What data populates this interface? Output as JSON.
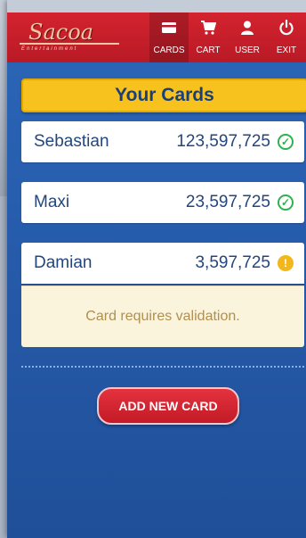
{
  "brand": {
    "logo_text": "Sacoa",
    "logo_sub": "Entertainment"
  },
  "nav": [
    {
      "label": "CARDS",
      "icon": "card-icon"
    },
    {
      "label": "CART",
      "icon": "cart-icon"
    },
    {
      "label": "USER",
      "icon": "user-icon"
    },
    {
      "label": "EXIT",
      "icon": "power-icon"
    }
  ],
  "section_title": "Your Cards",
  "cards": [
    {
      "name": "Sebastian",
      "balance": "123,597,725",
      "status": "valid"
    },
    {
      "name": "Maxi",
      "balance": "23,597,725",
      "status": "valid"
    },
    {
      "name": "Damian",
      "balance": "3,597,725",
      "status": "warning"
    }
  ],
  "notice": "Card requires validation.",
  "add_button": "ADD NEW CARD",
  "colors": {
    "header_red": "#d3232f",
    "accent_yellow": "#f7c21d",
    "background_blue": "#2c67b9",
    "valid_green": "#2eb24d",
    "warning_yellow": "#f2b81b"
  }
}
